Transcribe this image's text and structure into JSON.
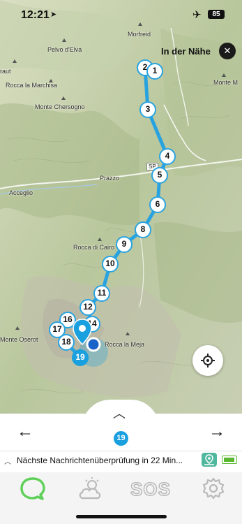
{
  "status": {
    "time": "12:21",
    "battery": "85"
  },
  "nearby": {
    "label": "In der Nähe"
  },
  "places": {
    "morfreid": "Morfreid",
    "pelvo": "Pelvo d'Elva",
    "raut": "raut",
    "marchisa": "Rocca la Marchisa",
    "montem": "Monte M",
    "chersogno": "Monte Chersogno",
    "prazzo": "Prazzo",
    "acceglio": "Acceglio",
    "cairo": "Rocca di Cairo",
    "oserot": "Monte Oserot",
    "meja": "Rocca la Meja",
    "road": "SP"
  },
  "route": {
    "waypoints": [
      "2",
      "1",
      "3",
      "4",
      "5",
      "6",
      "8",
      "9",
      "10",
      "11",
      "12",
      "14",
      "16",
      "17",
      "18",
      "19"
    ],
    "current": "19",
    "color": "#29a3e0"
  },
  "sheet": {
    "count": "19",
    "message": "Nächste Nachrichtenüberprüfung in 22 Min..."
  },
  "tabs": [
    "messages",
    "weather",
    "sos",
    "settings"
  ],
  "tab_labels": {
    "sos": "SOS"
  },
  "colors": {
    "accent": "#1aa0de",
    "active_tab": "#5fd15a"
  }
}
